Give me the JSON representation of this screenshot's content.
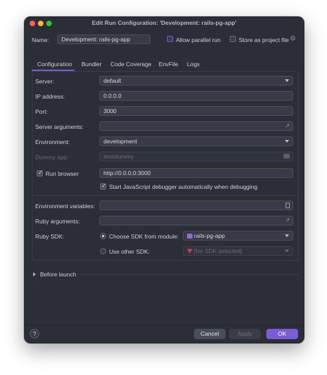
{
  "window": {
    "title": "Edit Run Configuration: 'Development: rails-pg-app'"
  },
  "name_row": {
    "label": "Name:",
    "value": "Development: rails-pg-app",
    "allow_parallel": "Allow parallel run",
    "store_project": "Store as project file"
  },
  "tabs": [
    {
      "label": "Configuration"
    },
    {
      "label": "Bundler"
    },
    {
      "label": "Code Coverage"
    },
    {
      "label": "EnvFile"
    },
    {
      "label": "Logs"
    }
  ],
  "form": {
    "server_label": "Server:",
    "server_value": "default",
    "ip_label": "IP address:",
    "ip_value": "0.0.0.0",
    "port_label": "Port:",
    "port_value": "3000",
    "server_args_label": "Server arguments:",
    "server_args_value": "",
    "env_label": "Environment:",
    "env_value": "development",
    "dummy_label": "Dummy app:",
    "dummy_value": "test/dummy",
    "run_browser_label": "Run browser",
    "run_browser_url": "http://0.0.0.0:3000",
    "js_debugger_label": "Start JavaScript debugger automatically when debugging",
    "env_vars_label": "Environment variables:",
    "env_vars_value": "",
    "ruby_args_label": "Ruby arguments:",
    "ruby_args_value": "",
    "ruby_sdk_label": "Ruby SDK:",
    "choose_sdk_label": "Choose SDK from module:",
    "choose_sdk_value": "rails-pg-app",
    "other_sdk_label": "Use other SDK:",
    "other_sdk_value": "[No SDK selected]"
  },
  "before_launch": "Before launch",
  "footer": {
    "help": "?",
    "cancel": "Cancel",
    "apply": "Apply",
    "ok": "OK"
  },
  "colors": {
    "accent": "#7c5cd6",
    "ruby_red": "#c23b57",
    "window_bg": "#2b2d37"
  }
}
